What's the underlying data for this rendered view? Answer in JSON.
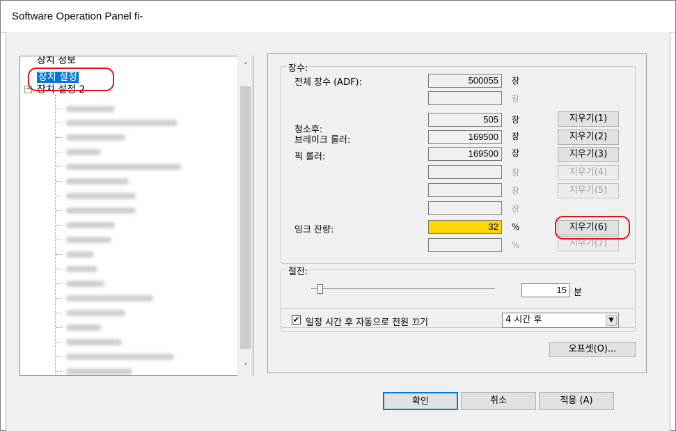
{
  "window": {
    "title": "Software Operation Panel fi-"
  },
  "tree": {
    "item_info": "장치 정보",
    "item_settings": "장치 설정",
    "item_settings2": "장치 설정 2",
    "expander": "−"
  },
  "counts": {
    "group_label": "장수:",
    "total_adf_label": "전체 장수 (ADF):",
    "total_adf_value": "500055",
    "after_cleaning_label": "청소후:",
    "after_cleaning_value": "505",
    "brake_roller_label": "브레이크 롤러:",
    "brake_roller_value": "169500",
    "pick_roller_label": "픽 롤러:",
    "pick_roller_value": "169500",
    "ink_label": "잉크 잔량:",
    "ink_value": "32",
    "unit_sheets": "장",
    "unit_percent": "%",
    "clear1": "지우기(1)",
    "clear2": "지우기(2)",
    "clear3": "지우기(3)",
    "clear4": "지우기(4)",
    "clear5": "지우기(5)",
    "clear6": "지우기(6)",
    "clear7": "지우기(7)"
  },
  "power": {
    "group_label": "절전:",
    "value": "15",
    "unit": "분",
    "slider_level": 0.05,
    "auto_off_label": "일정 시간 후 자동으로 전원 끄기",
    "auto_off_checked": true,
    "auto_off_selected": "4 시간 후",
    "check_mark": "✔"
  },
  "offset_button": "오프셋(O)...",
  "footer": {
    "ok": "확인",
    "cancel": "취소",
    "apply": "적용 (A)"
  },
  "icons": {
    "scroll_up": "˄",
    "scroll_down": "˅",
    "dropdown": "▼"
  },
  "colors": {
    "selection": "#0078d7",
    "ink_field": "#ffd700",
    "highlight": "#e01010"
  }
}
